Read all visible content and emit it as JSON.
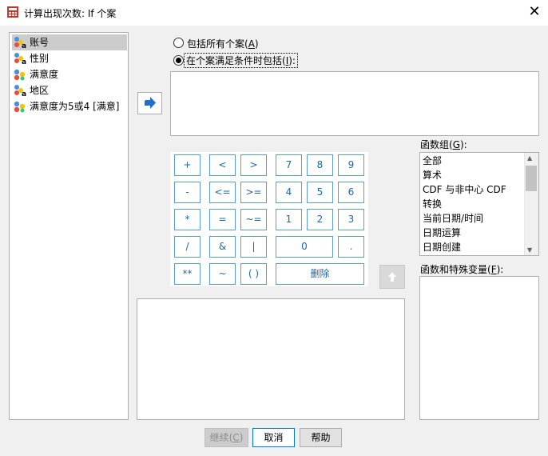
{
  "window": {
    "title": "计算出现次数: If 个案",
    "icons": {
      "app": "calculator-app-icon",
      "close": "close-icon"
    }
  },
  "variables": [
    {
      "label": "账号",
      "icon": "nominal-string-variable-icon",
      "selected": true
    },
    {
      "label": "性别",
      "icon": "nominal-string-variable-icon",
      "selected": false
    },
    {
      "label": "满意度",
      "icon": "nominal-numeric-variable-icon",
      "selected": false
    },
    {
      "label": "地区",
      "icon": "nominal-string-variable-icon",
      "selected": false
    },
    {
      "label": "满意度为5或4 [满意]",
      "icon": "nominal-numeric-variable-icon",
      "selected": false
    }
  ],
  "options": {
    "all_cases": {
      "text": "包括所有个案(",
      "key": "A",
      "suffix": ")",
      "selected": false
    },
    "if_condition": {
      "text": "在个案满足条件时包括(",
      "key": "I",
      "suffix": "):",
      "selected": true
    }
  },
  "transfer_button": {
    "icon": "right-arrow-icon"
  },
  "condition_text": "",
  "keypad": {
    "keys": [
      "+",
      "<",
      ">",
      "7",
      "8",
      "9",
      "-",
      "<=",
      ">=",
      "4",
      "5",
      "6",
      "*",
      "=",
      "~=",
      "1",
      "2",
      "3",
      "/",
      "&",
      "|",
      "0",
      ".",
      "**",
      "~",
      "( )",
      "删除"
    ]
  },
  "move_up_button": {
    "icon": "up-arrow-icon"
  },
  "expression_text": "",
  "function_group": {
    "label": "函数组(",
    "key": "G",
    "suffix": "):",
    "items": [
      "全部",
      "算术",
      "CDF 与非中心 CDF",
      "转换",
      "当前日期/时间",
      "日期运算",
      "日期创建"
    ]
  },
  "functions_vars": {
    "label": "函数和特殊变量(",
    "key": "F",
    "suffix": "):",
    "items": []
  },
  "buttons": {
    "continue": {
      "text": "继续(",
      "key": "C",
      "suffix": ")",
      "enabled": false
    },
    "cancel": {
      "text": "取消"
    },
    "help": {
      "text": "帮助"
    }
  }
}
